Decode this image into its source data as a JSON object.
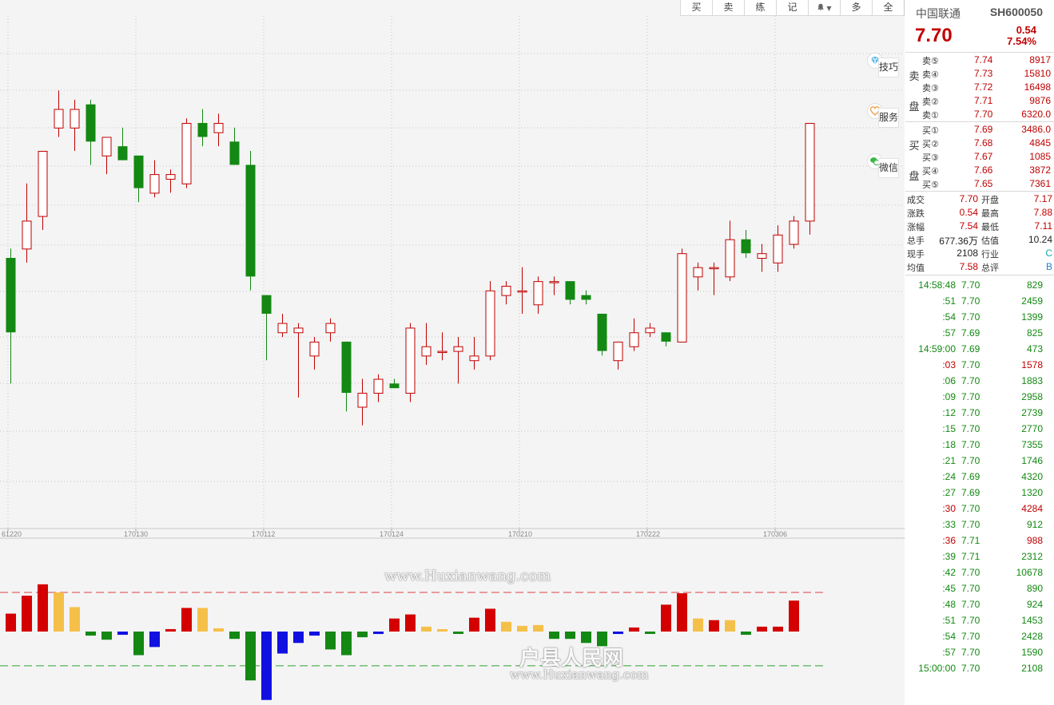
{
  "toolbar": {
    "buy": "买",
    "sell": "卖",
    "practice": "练",
    "note": "记",
    "more": "多",
    "full": "全"
  },
  "side_buttons": {
    "tips": "技巧",
    "service": "服务",
    "wechat": "微信"
  },
  "watermarks": {
    "url_top": "www.Huxianwang.com",
    "site_name": "户县人民网",
    "url_bottom": "www.Huxianwang.com"
  },
  "colors": {
    "up": "#c00000",
    "down": "#138813",
    "bar_red": "#d40000",
    "bar_orange": "#f5c04a",
    "bar_green": "#138813",
    "bar_blue": "#1010e0"
  },
  "quote": {
    "name": "中国联通",
    "code": "SH600050",
    "price": "7.70",
    "change": "0.54",
    "change_pct": "7.54%"
  },
  "order_book": {
    "sell_label": "卖盘",
    "buy_label": "买盘",
    "asks": [
      {
        "label": "卖⑤",
        "price": "7.74",
        "volume": "8917"
      },
      {
        "label": "卖④",
        "price": "7.73",
        "volume": "15810"
      },
      {
        "label": "卖③",
        "price": "7.72",
        "volume": "16498"
      },
      {
        "label": "卖②",
        "price": "7.71",
        "volume": "9876"
      },
      {
        "label": "卖①",
        "price": "7.70",
        "volume": "6320.0"
      }
    ],
    "bids": [
      {
        "label": "买①",
        "price": "7.69",
        "volume": "3486.0"
      },
      {
        "label": "买②",
        "price": "7.68",
        "volume": "4845"
      },
      {
        "label": "买③",
        "price": "7.67",
        "volume": "1085"
      },
      {
        "label": "买④",
        "price": "7.66",
        "volume": "3872"
      },
      {
        "label": "买⑤",
        "price": "7.65",
        "volume": "7361"
      }
    ]
  },
  "stats": [
    {
      "l1": "成交",
      "v1": "7.70",
      "l2": "开盘",
      "v2": "7.17"
    },
    {
      "l1": "涨跌",
      "v1": "0.54",
      "l2": "最高",
      "v2": "7.88"
    },
    {
      "l1": "涨幅",
      "v1": "7.54",
      "l2": "最低",
      "v2": "7.11"
    },
    {
      "l1": "总手",
      "v1": "677.36万",
      "l2": "估值",
      "v2": "10.24"
    },
    {
      "l1": "现手",
      "v1": "2108",
      "l2": "行业",
      "v2": "C"
    },
    {
      "l1": "均值",
      "v1": "7.58",
      "l2": "总评",
      "v2": "B"
    }
  ],
  "ticks": [
    {
      "time": "14:58:48",
      "price": "7.70",
      "volume": "829",
      "dir": "s"
    },
    {
      "time": ":51",
      "price": "7.70",
      "volume": "2459",
      "dir": "s"
    },
    {
      "time": ":54",
      "price": "7.70",
      "volume": "1399",
      "dir": "s"
    },
    {
      "time": ":57",
      "price": "7.69",
      "volume": "825",
      "dir": "s"
    },
    {
      "time": "14:59:00",
      "price": "7.69",
      "volume": "473",
      "dir": "s"
    },
    {
      "time": ":03",
      "price": "7.70",
      "volume": "1578",
      "dir": "b"
    },
    {
      "time": ":06",
      "price": "7.70",
      "volume": "1883",
      "dir": "s"
    },
    {
      "time": ":09",
      "price": "7.70",
      "volume": "2958",
      "dir": "s"
    },
    {
      "time": ":12",
      "price": "7.70",
      "volume": "2739",
      "dir": "s"
    },
    {
      "time": ":15",
      "price": "7.70",
      "volume": "2770",
      "dir": "s"
    },
    {
      "time": ":18",
      "price": "7.70",
      "volume": "7355",
      "dir": "s"
    },
    {
      "time": ":21",
      "price": "7.70",
      "volume": "1746",
      "dir": "s"
    },
    {
      "time": ":24",
      "price": "7.69",
      "volume": "4320",
      "dir": "s"
    },
    {
      "time": ":27",
      "price": "7.69",
      "volume": "1320",
      "dir": "s"
    },
    {
      "time": ":30",
      "price": "7.70",
      "volume": "4284",
      "dir": "b"
    },
    {
      "time": ":33",
      "price": "7.70",
      "volume": "912",
      "dir": "s"
    },
    {
      "time": ":36",
      "price": "7.71",
      "volume": "988",
      "dir": "b"
    },
    {
      "time": ":39",
      "price": "7.71",
      "volume": "2312",
      "dir": "s"
    },
    {
      "time": ":42",
      "price": "7.70",
      "volume": "10678",
      "dir": "s"
    },
    {
      "time": ":45",
      "price": "7.70",
      "volume": "890",
      "dir": "s"
    },
    {
      "time": ":48",
      "price": "7.70",
      "volume": "924",
      "dir": "s"
    },
    {
      "time": ":51",
      "price": "7.70",
      "volume": "1453",
      "dir": "s"
    },
    {
      "time": ":54",
      "price": "7.70",
      "volume": "2428",
      "dir": "s"
    },
    {
      "time": ":57",
      "price": "7.70",
      "volume": "1590",
      "dir": "s"
    },
    {
      "time": "15:00:00",
      "price": "7.70",
      "volume": "2108",
      "dir": "s"
    }
  ],
  "chart_data": [
    {
      "type": "candlestick",
      "x_tick_labels": [
        "61220",
        "170130",
        "170112",
        "170124",
        "170210",
        "170222",
        "170306"
      ],
      "y_unit": "price",
      "candles": [
        {
          "o": 6.88,
          "h": 6.9,
          "l": 6.61,
          "c": 6.72
        },
        {
          "o": 6.9,
          "h": 7.04,
          "l": 6.87,
          "c": 6.96
        },
        {
          "o": 6.97,
          "h": 7.11,
          "l": 6.94,
          "c": 7.11
        },
        {
          "o": 7.16,
          "h": 7.24,
          "l": 7.14,
          "c": 7.2
        },
        {
          "o": 7.16,
          "h": 7.22,
          "l": 7.11,
          "c": 7.2
        },
        {
          "o": 7.21,
          "h": 7.22,
          "l": 7.08,
          "c": 7.13
        },
        {
          "o": 7.1,
          "h": 7.14,
          "l": 7.06,
          "c": 7.14
        },
        {
          "o": 7.12,
          "h": 7.16,
          "l": 7.09,
          "c": 7.09
        },
        {
          "o": 7.1,
          "h": 7.1,
          "l": 7.0,
          "c": 7.03
        },
        {
          "o": 7.02,
          "h": 7.09,
          "l": 7.01,
          "c": 7.06
        },
        {
          "o": 7.05,
          "h": 7.07,
          "l": 7.02,
          "c": 7.06
        },
        {
          "o": 7.04,
          "h": 7.18,
          "l": 7.03,
          "c": 7.17
        },
        {
          "o": 7.17,
          "h": 7.2,
          "l": 7.12,
          "c": 7.14
        },
        {
          "o": 7.15,
          "h": 7.19,
          "l": 7.12,
          "c": 7.17
        },
        {
          "o": 7.13,
          "h": 7.16,
          "l": 7.08,
          "c": 7.08
        },
        {
          "o": 7.08,
          "h": 7.11,
          "l": 6.81,
          "c": 6.84
        },
        {
          "o": 6.8,
          "h": 6.8,
          "l": 6.66,
          "c": 6.76
        },
        {
          "o": 6.72,
          "h": 6.76,
          "l": 6.71,
          "c": 6.74
        },
        {
          "o": 6.72,
          "h": 6.74,
          "l": 6.58,
          "c": 6.73
        },
        {
          "o": 6.67,
          "h": 6.71,
          "l": 6.64,
          "c": 6.7
        },
        {
          "o": 6.72,
          "h": 6.75,
          "l": 6.7,
          "c": 6.74
        },
        {
          "o": 6.7,
          "h": 6.7,
          "l": 6.55,
          "c": 6.59
        },
        {
          "o": 6.56,
          "h": 6.62,
          "l": 6.52,
          "c": 6.59
        },
        {
          "o": 6.59,
          "h": 6.63,
          "l": 6.57,
          "c": 6.62
        },
        {
          "o": 6.61,
          "h": 6.62,
          "l": 6.6,
          "c": 6.6
        },
        {
          "o": 6.59,
          "h": 6.74,
          "l": 6.57,
          "c": 6.73
        },
        {
          "o": 6.67,
          "h": 6.74,
          "l": 6.65,
          "c": 6.69
        },
        {
          "o": 6.68,
          "h": 6.72,
          "l": 6.66,
          "c": 6.68
        },
        {
          "o": 6.68,
          "h": 6.71,
          "l": 6.61,
          "c": 6.69
        },
        {
          "o": 6.66,
          "h": 6.71,
          "l": 6.64,
          "c": 6.67
        },
        {
          "o": 6.67,
          "h": 6.83,
          "l": 6.66,
          "c": 6.81
        },
        {
          "o": 6.8,
          "h": 6.83,
          "l": 6.78,
          "c": 6.82
        },
        {
          "o": 6.81,
          "h": 6.86,
          "l": 6.76,
          "c": 6.81
        },
        {
          "o": 6.78,
          "h": 6.84,
          "l": 6.76,
          "c": 6.83
        },
        {
          "o": 6.83,
          "h": 6.84,
          "l": 6.8,
          "c": 6.83
        },
        {
          "o": 6.83,
          "h": 6.83,
          "l": 6.78,
          "c": 6.79
        },
        {
          "o": 6.8,
          "h": 6.81,
          "l": 6.78,
          "c": 6.79
        },
        {
          "o": 6.76,
          "h": 6.76,
          "l": 6.67,
          "c": 6.68
        },
        {
          "o": 6.66,
          "h": 6.7,
          "l": 6.64,
          "c": 6.7
        },
        {
          "o": 6.69,
          "h": 6.75,
          "l": 6.68,
          "c": 6.72
        },
        {
          "o": 6.72,
          "h": 6.74,
          "l": 6.71,
          "c": 6.73
        },
        {
          "o": 6.72,
          "h": 6.72,
          "l": 6.69,
          "c": 6.7
        },
        {
          "o": 6.7,
          "h": 6.9,
          "l": 6.7,
          "c": 6.89
        },
        {
          "o": 6.84,
          "h": 6.87,
          "l": 6.81,
          "c": 6.86
        },
        {
          "o": 6.86,
          "h": 6.87,
          "l": 6.8,
          "c": 6.86
        },
        {
          "o": 6.84,
          "h": 6.96,
          "l": 6.83,
          "c": 6.92
        },
        {
          "o": 6.92,
          "h": 6.94,
          "l": 6.88,
          "c": 6.89
        },
        {
          "o": 6.88,
          "h": 6.91,
          "l": 6.85,
          "c": 6.89
        },
        {
          "o": 6.87,
          "h": 6.95,
          "l": 6.85,
          "c": 6.93
        },
        {
          "o": 6.91,
          "h": 6.97,
          "l": 6.9,
          "c": 6.96
        },
        {
          "o": 6.96,
          "h": 7.17,
          "l": 6.93,
          "c": 7.17
        }
      ]
    },
    {
      "type": "bar",
      "series": [
        {
          "values": [
            0.22,
            0.44,
            0.58,
            0.48,
            0.3,
            -0.05,
            -0.1,
            -0.04,
            -0.29,
            -0.19,
            0.03,
            0.29,
            0.29,
            0.04,
            -0.09,
            -0.6,
            -0.84,
            -0.27,
            -0.14,
            -0.05,
            -0.22,
            -0.29,
            -0.07,
            -0.03,
            0.16,
            0.21,
            0.06,
            0.01,
            -0.01,
            0.17,
            0.28,
            0.12,
            0.07,
            0.08,
            -0.09,
            -0.09,
            -0.14,
            -0.18,
            -0.03,
            0.05,
            -0.02,
            0.33,
            0.47,
            0.16,
            0.14,
            0.14,
            -0.04,
            0.06,
            0.06,
            0.38
          ],
          "colors": [
            "red",
            "red",
            "red",
            "orange",
            "orange",
            "green",
            "green",
            "blue",
            "green",
            "blue",
            "red",
            "red",
            "orange",
            "orange",
            "green",
            "green",
            "blue",
            "blue",
            "blue",
            "blue",
            "green",
            "green",
            "green",
            "blue",
            "red",
            "red",
            "orange",
            "orange",
            "green",
            "red",
            "red",
            "orange",
            "orange",
            "orange",
            "green",
            "green",
            "green",
            "green",
            "blue",
            "red",
            "green",
            "red",
            "red",
            "orange",
            "red",
            "orange",
            "green",
            "red",
            "red",
            "red"
          ]
        }
      ],
      "reference_lines": [
        0.48,
        -0.42
      ]
    }
  ]
}
